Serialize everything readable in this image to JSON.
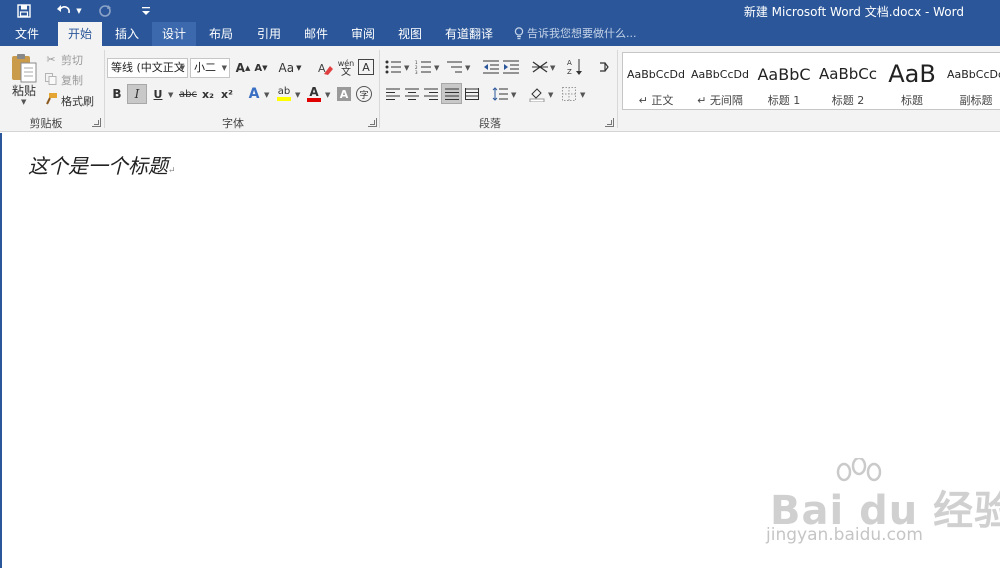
{
  "window": {
    "title": "新建 Microsoft Word 文档.docx - Word",
    "theme_color": "#2b579a"
  },
  "quick_access": [
    "save-icon",
    "undo-icon",
    "redo-icon",
    "customize-icon"
  ],
  "tabs": [
    {
      "label": "文件"
    },
    {
      "label": "开始",
      "active": true
    },
    {
      "label": "插入"
    },
    {
      "label": "设计"
    },
    {
      "label": "布局"
    },
    {
      "label": "引用"
    },
    {
      "label": "邮件"
    },
    {
      "label": "审阅"
    },
    {
      "label": "视图"
    },
    {
      "label": "有道翻译"
    }
  ],
  "tell_me": "告诉我您想要做什么...",
  "clipboard": {
    "paste": "粘贴",
    "cut": "剪切",
    "copy": "复制",
    "format_painter": "格式刷",
    "group_label": "剪贴板"
  },
  "font": {
    "font_name": "等线 (中文正文",
    "font_size": "小二",
    "case_label": "Aa",
    "phonetic_top": "wén",
    "phonetic_bottom": "文",
    "group_label": "字体",
    "bold": "B",
    "italic": "I",
    "underline": "U",
    "strike": "abc",
    "subscript": "x₂",
    "superscript": "x²",
    "enclose": "字",
    "char_border": "A",
    "grow": "A",
    "shrink": "A",
    "text_effect": "A",
    "highlight": "ab",
    "font_color": "A",
    "shading": "A",
    "highlight_color": "#ffff00",
    "font_color_value": "#e00000"
  },
  "paragraph": {
    "group_label": "段落"
  },
  "styles": [
    {
      "sample": "AaBbCcDd",
      "name": "↵ 正文"
    },
    {
      "sample": "AaBbCcDd",
      "name": "↵ 无间隔"
    },
    {
      "sample": "AaBbC",
      "name": "标题 1"
    },
    {
      "sample": "AaBbCc",
      "name": "标题 2"
    },
    {
      "sample": "AaB",
      "name": "标题"
    },
    {
      "sample": "AaBbCcDd",
      "name": "副标题"
    }
  ],
  "document": {
    "text": "这个是一个标题",
    "paragraph_mark": "↵"
  },
  "watermark": {
    "logo": "Bai du 经验",
    "url": "jingyan.baidu.com"
  }
}
